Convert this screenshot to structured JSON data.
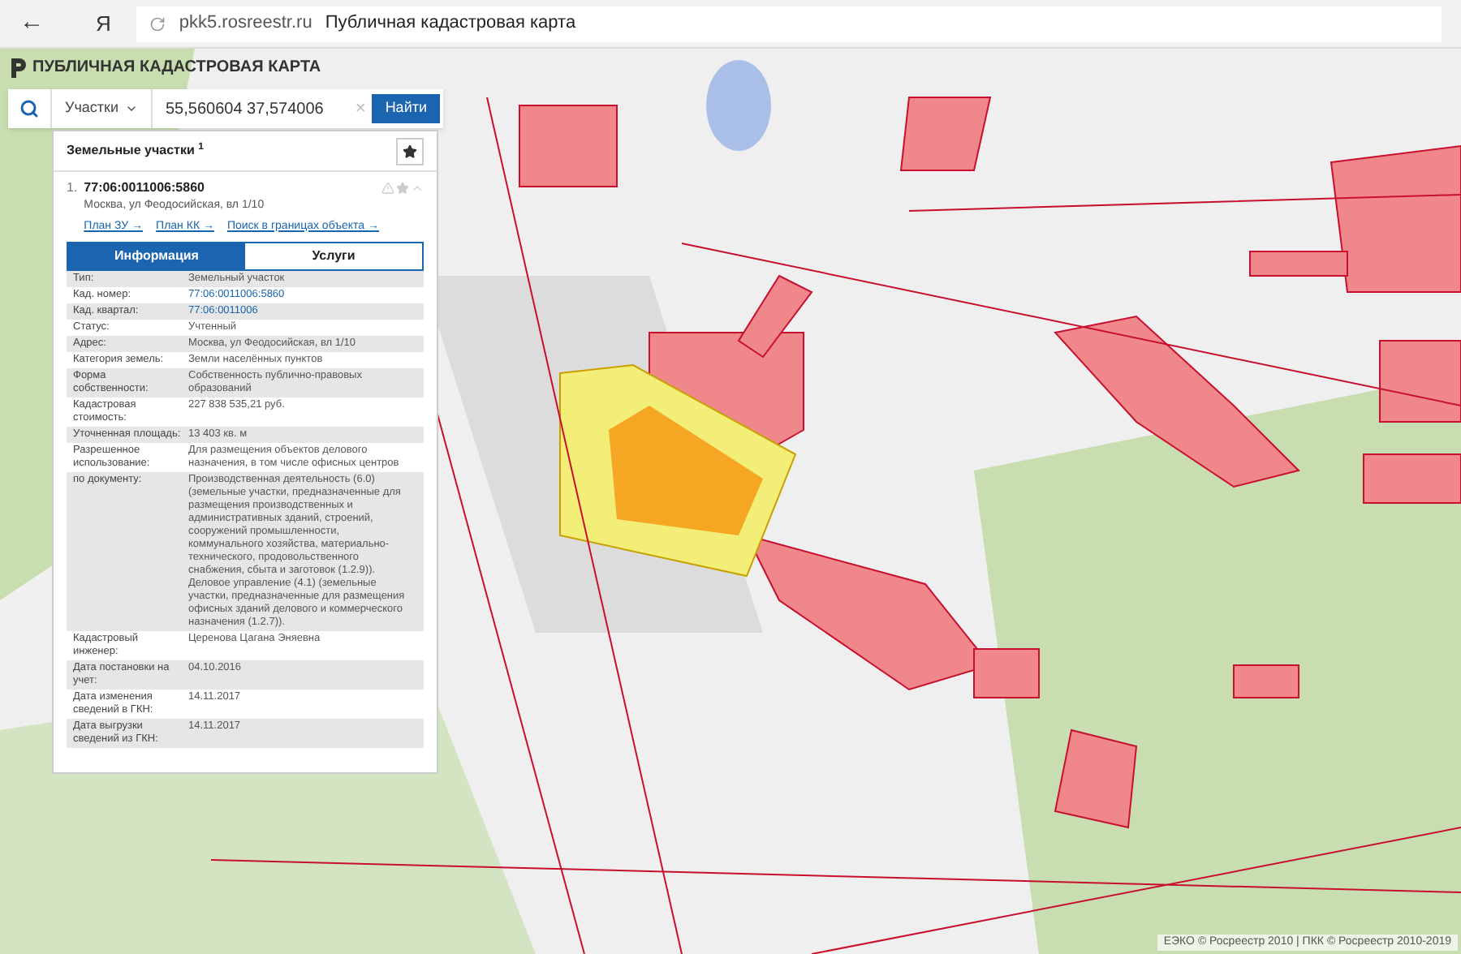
{
  "browser": {
    "back": "←",
    "logo": "Я",
    "url": "pkk5.rosreestr.ru",
    "title": "Публичная кадастровая карта"
  },
  "app_title": "ПУБЛИЧНАЯ КАДАСТРОВАЯ КАРТА",
  "search": {
    "category": "Участки",
    "value": "55,560604 37,574006",
    "clear": "×",
    "button": "Найти"
  },
  "results": {
    "title": "Земельные участки $^{1}$",
    "item": {
      "index": "1.",
      "number": "77:06:0011006:5860",
      "address": "Москва, ул Феодосийская, вл 1/10",
      "links": [
        "План ЗУ →",
        "План КК →",
        "Поиск в границах объекта →"
      ],
      "tabs": [
        {
          "label": "Информация",
          "selected": true
        },
        {
          "label": "Услуги",
          "selected": false
        }
      ],
      "rows": [
        {
          "label": "Тип:",
          "value": "Земельный участок",
          "kind": "text"
        },
        {
          "label": "Кад. номер:",
          "value": "77:06:0011006:5860",
          "kind": "link"
        },
        {
          "label": "Кад. квартал:",
          "value": "77:06:0011006",
          "kind": "link"
        },
        {
          "label": "Статус:",
          "value": "Учтенный",
          "kind": "text"
        },
        {
          "label": "Адрес:",
          "value": "Москва, ул Феодосийская, вл 1/10",
          "kind": "text"
        },
        {
          "label": "Категория земель:",
          "value": "Земли населённых пунктов",
          "kind": "text"
        },
        {
          "label": "Форма собственности:",
          "value": "Собственность публично-правовых образований",
          "kind": "text"
        },
        {
          "label": "Кадастровая стоимость:",
          "value": "227 838 535,21 руб.",
          "kind": "text"
        },
        {
          "label": "Уточненная площадь:",
          "value": "13 403 кв. м",
          "kind": "text"
        },
        {
          "label": "Разрешенное использование:",
          "value": "Для размещения объектов делового назначения, в том числе офисных центров",
          "kind": "text"
        },
        {
          "label": "по документу:",
          "value": "Производственная деятельность (6.0) (земельные участки, предназначенные для размещения производственных и административных зданий, строений, сооружений промышленности, коммунального хозяйства, материально-технического, продовольственного снабжения, сбыта и заготовок (1.2.9)). Деловое управление (4.1) (земельные участки, предназначенные для размещения офисных зданий делового и коммерческого назначения (1.2.7)).",
          "kind": "text"
        },
        {
          "label": "Кадастровый инженер:",
          "value": "Церенова Цагана Эняевна",
          "kind": "text"
        },
        {
          "label": "Дата постановки на учет:",
          "value": "04.10.2016",
          "kind": "text"
        },
        {
          "label": "Дата изменения сведений в ГКН:",
          "value": "14.11.2017",
          "kind": "text"
        },
        {
          "label": "Дата выгрузки сведений из ГКН:",
          "value": "14.11.2017",
          "kind": "text"
        }
      ]
    }
  },
  "attribution": "ЕЭКО © Росреестр 2010 | ПКК © Росреестр 2010-2019"
}
